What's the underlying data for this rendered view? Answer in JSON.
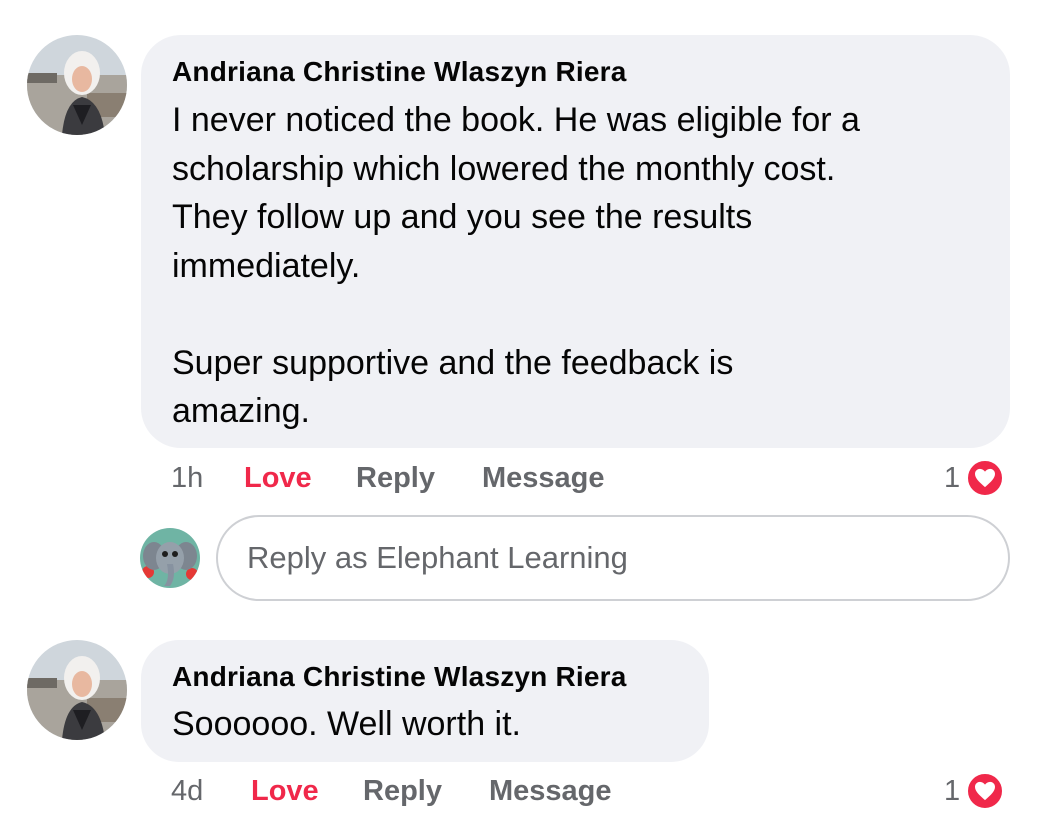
{
  "comments": [
    {
      "author": "Andriana Christine Wlaszyn Riera",
      "paragraphs": [
        "I never noticed the book.  He was eligible for a\nscholarship which lowered the monthly cost.\nThey follow up and you see the results\nimmediately.",
        "Super supportive and the feedback is\namazing."
      ],
      "time": "1h",
      "love_label": "Love",
      "reply_label": "Reply",
      "message_label": "Message",
      "reaction_count": "1",
      "reaction_icon": "heart-icon"
    },
    {
      "author": "Andriana Christine Wlaszyn Riera",
      "paragraphs": [
        "Soooooo. Well worth it."
      ],
      "time": "4d",
      "love_label": "Love",
      "reply_label": "Reply",
      "message_label": "Message",
      "reaction_count": "1",
      "reaction_icon": "heart-icon"
    }
  ],
  "reply_composer": {
    "placeholder": "Reply as Elephant Learning",
    "avatar_icon": "elephant-avatar-icon"
  },
  "colors": {
    "bubble": "#f0f1f5",
    "love_active": "#f0284a",
    "meta_text": "#65676b",
    "input_border": "#ced0d4"
  }
}
